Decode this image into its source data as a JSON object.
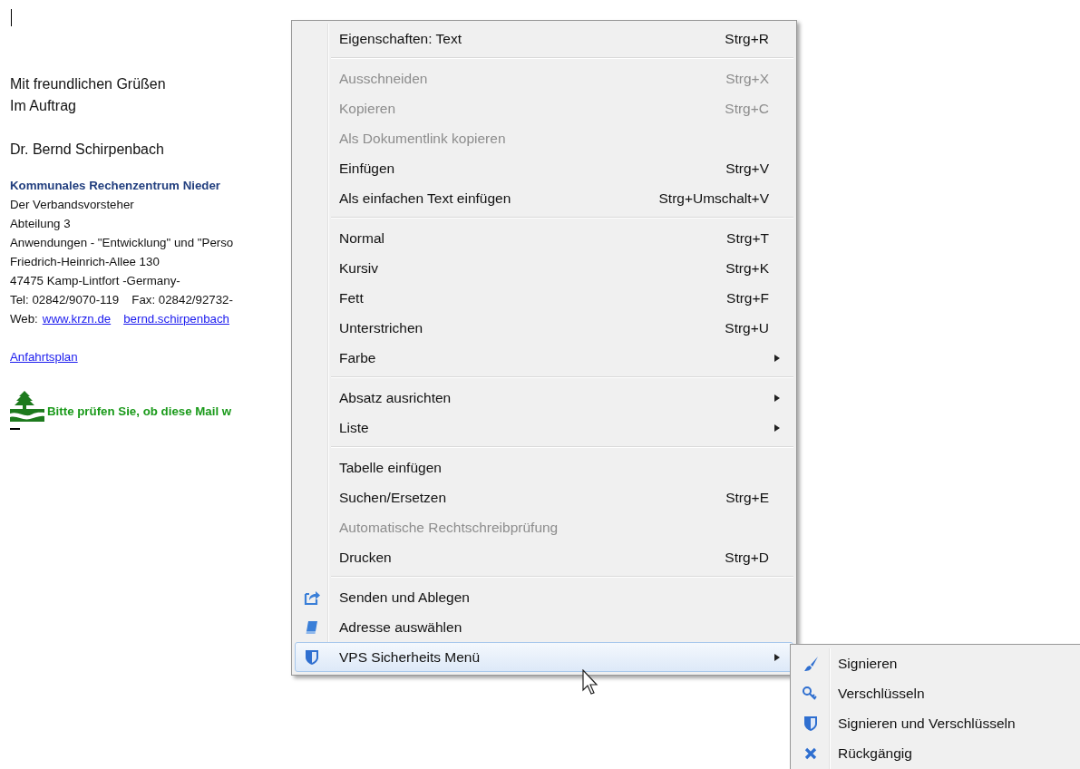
{
  "document": {
    "closing": [
      "Mit freundlichen Grüßen",
      "Im Auftrag"
    ],
    "signer": "Dr. Bernd Schirpenbach",
    "signature": {
      "organization": "Kommunales Rechenzentrum Nieder",
      "lines": [
        [
          {
            "text": "Der Verbandsvorsteher",
            "link": false
          }
        ],
        [
          {
            "text": "Abteilung 3",
            "link": false
          }
        ],
        [
          {
            "text": "Anwendungen - \"Entwicklung\" und \"Perso",
            "link": false
          }
        ],
        [
          {
            "text": "Friedrich-Heinrich-Allee 130",
            "link": false
          }
        ],
        [
          {
            "text": "47475 Kamp-Lintfort -Germany-",
            "link": false
          }
        ],
        [
          {
            "text": "Tel: 02842/9070-119",
            "link": false
          },
          {
            "text": "Fax: 02842/92732-",
            "link": false
          }
        ],
        [
          {
            "text": "Web:",
            "link": false
          },
          {
            "text": "www.krzn.de",
            "link": true
          },
          {
            "text": "bernd.schirpenbach",
            "link": true
          }
        ]
      ]
    },
    "directions_link": "Anfahrtsplan",
    "notice": "Bitte prüfen Sie, ob diese Mail w"
  },
  "context_menu": {
    "groups": [
      [
        {
          "label": "Eigenschaften: Text",
          "shortcut": "Strg+R",
          "disabled": false,
          "has_submenu": false,
          "selected": false
        }
      ],
      [
        {
          "label": "Ausschneiden",
          "shortcut": "Strg+X",
          "disabled": true,
          "has_submenu": false,
          "selected": false
        },
        {
          "label": "Kopieren",
          "shortcut": "Strg+C",
          "disabled": true,
          "has_submenu": false,
          "selected": false
        },
        {
          "label": "Als Dokumentlink kopieren",
          "disabled": true,
          "has_submenu": false,
          "selected": false
        },
        {
          "label": "Einfügen",
          "shortcut": "Strg+V",
          "disabled": false,
          "has_submenu": false,
          "selected": false
        },
        {
          "label": "Als einfachen Text einfügen",
          "shortcut": "Strg+Umschalt+V",
          "disabled": false,
          "has_submenu": false,
          "selected": false
        }
      ],
      [
        {
          "label": "Normal",
          "shortcut": "Strg+T",
          "disabled": false,
          "has_submenu": false,
          "selected": false
        },
        {
          "label": "Kursiv",
          "shortcut": "Strg+K",
          "disabled": false,
          "has_submenu": false,
          "selected": false
        },
        {
          "label": "Fett",
          "shortcut": "Strg+F",
          "disabled": false,
          "has_submenu": false,
          "selected": false
        },
        {
          "label": "Unterstrichen",
          "shortcut": "Strg+U",
          "disabled": false,
          "has_submenu": false,
          "selected": false
        },
        {
          "label": "Farbe",
          "disabled": false,
          "has_submenu": true,
          "selected": false
        }
      ],
      [
        {
          "label": "Absatz ausrichten",
          "disabled": false,
          "has_submenu": true,
          "selected": false
        },
        {
          "label": "Liste",
          "disabled": false,
          "has_submenu": true,
          "selected": false
        }
      ],
      [
        {
          "label": "Tabelle einfügen",
          "disabled": false,
          "has_submenu": false,
          "selected": false
        },
        {
          "label": "Suchen/Ersetzen",
          "shortcut": "Strg+E",
          "disabled": false,
          "has_submenu": false,
          "selected": false
        },
        {
          "label": "Automatische Rechtschreibprüfung",
          "disabled": true,
          "has_submenu": false,
          "selected": false
        },
        {
          "label": "Drucken",
          "shortcut": "Strg+D",
          "disabled": false,
          "has_submenu": false,
          "selected": false
        }
      ],
      [
        {
          "label": "Senden und Ablegen",
          "disabled": false,
          "has_submenu": false,
          "selected": false
        },
        {
          "label": "Adresse auswählen",
          "disabled": false,
          "has_submenu": false,
          "selected": false
        },
        {
          "label": "VPS Sicherheits Menü",
          "disabled": false,
          "has_submenu": true,
          "selected": true
        }
      ]
    ]
  },
  "submenu": {
    "items": [
      {
        "label": "Signieren"
      },
      {
        "label": "Verschlüsseln"
      },
      {
        "label": "Signieren und Verschlüsseln"
      },
      {
        "label": "Rückgängig"
      }
    ]
  }
}
